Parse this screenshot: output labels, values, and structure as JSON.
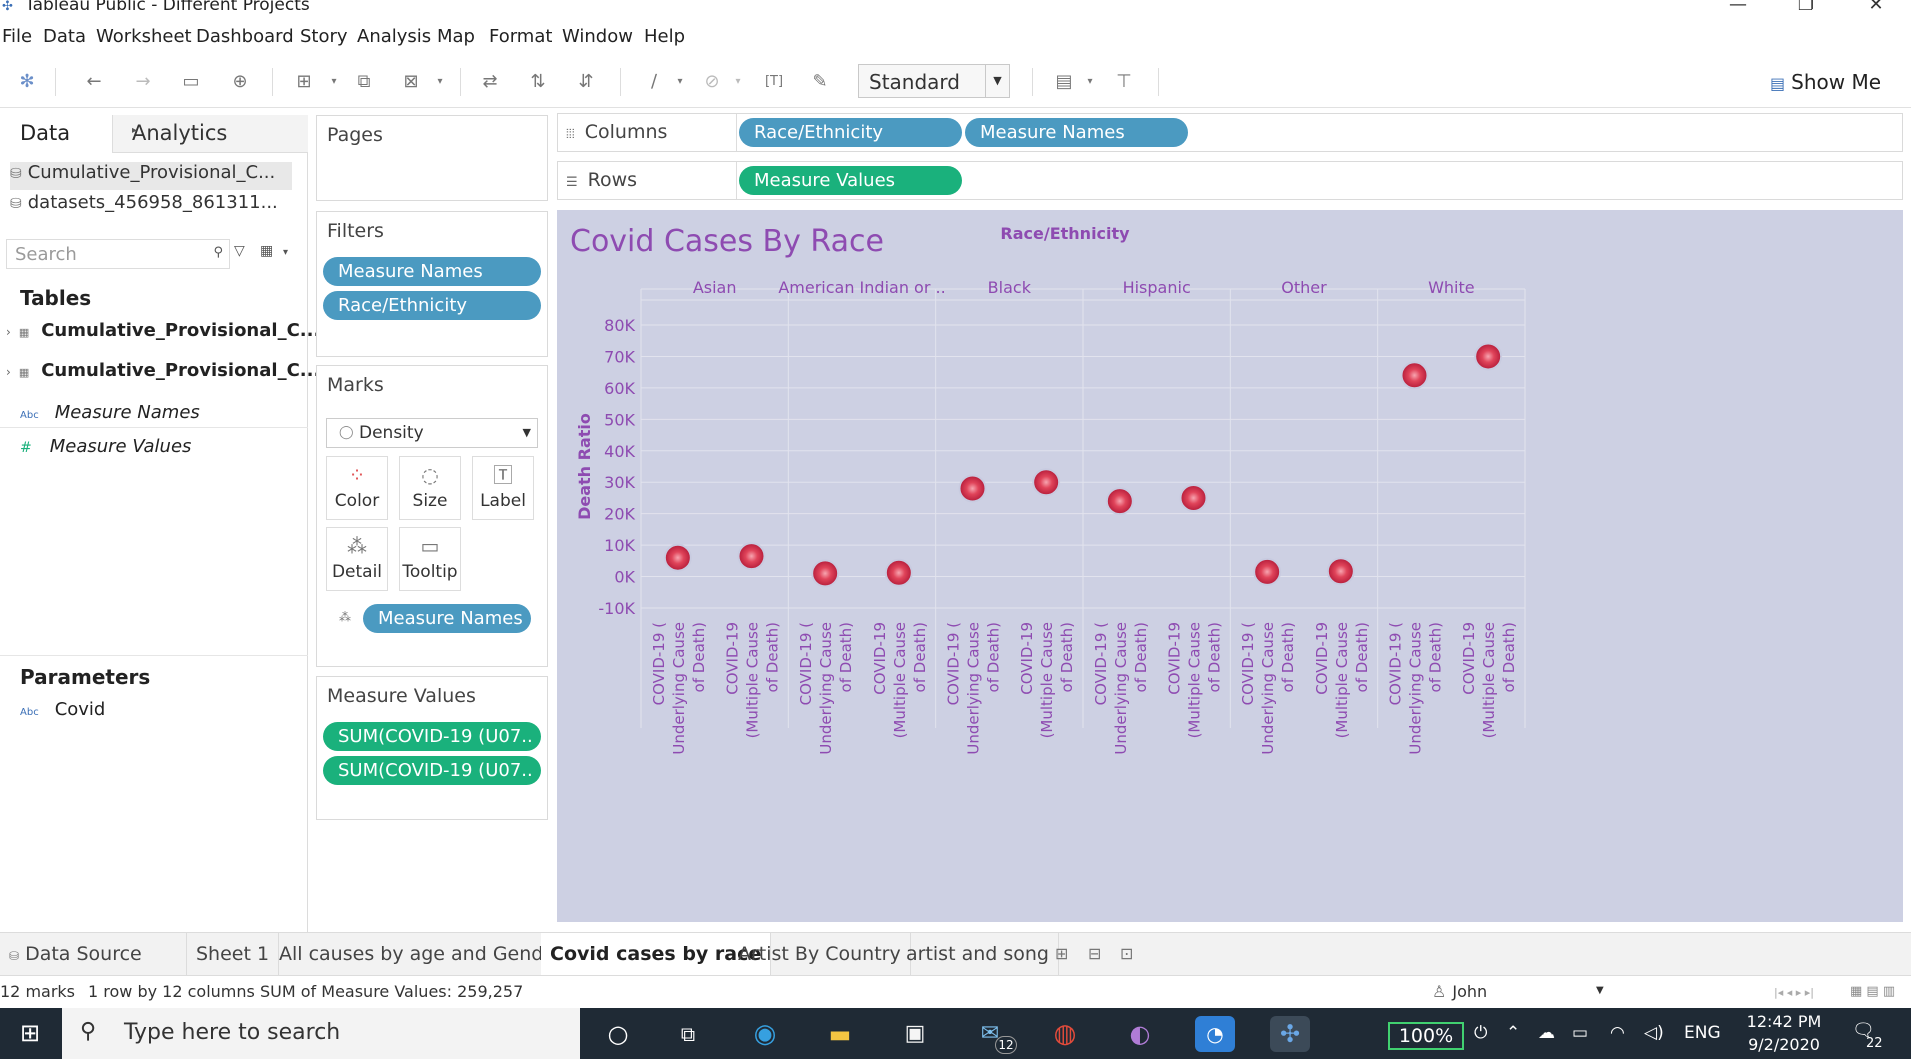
{
  "window": {
    "title": "Tableau Public - Different Projects"
  },
  "menu": [
    "File",
    "Data",
    "Worksheet",
    "Dashboard",
    "Story",
    "Analysis",
    "Map",
    "Format",
    "Window",
    "Help"
  ],
  "toolbar": {
    "fit_select": "Standard",
    "show_me": "Show Me"
  },
  "data_pane": {
    "tab_data": "Data",
    "tab_analytics": "Analytics",
    "datasources": [
      "Cumulative_Provisional_C...",
      "datasets_456958_861311..."
    ],
    "search_placeholder": "Search",
    "tables_heading": "Tables",
    "tables": [
      "Cumulative_Provisional_C...",
      "Cumulative_Provisional_C..."
    ],
    "fields": [
      "Measure Names",
      "Measure Values"
    ],
    "parameters_heading": "Parameters",
    "parameters": [
      "Covid"
    ]
  },
  "cards": {
    "pages": "Pages",
    "filters": "Filters",
    "filter_pills": [
      "Measure Names",
      "Race/Ethnicity"
    ],
    "marks": "Marks",
    "mark_type": "Density",
    "mark_buttons": [
      "Color",
      "Size",
      "Label",
      "Detail",
      "Tooltip"
    ],
    "marks_pill": "Measure Names",
    "measure_values": "Measure Values",
    "measure_pills": [
      "SUM(COVID-19 (U07..",
      "SUM(COVID-19 (U07.."
    ]
  },
  "shelves": {
    "columns_label": "Columns",
    "rows_label": "Rows",
    "columns_pills": [
      "Race/Ethnicity",
      "Measure Names"
    ],
    "rows_pills": [
      "Measure Values"
    ]
  },
  "viz": {
    "title": "Covid Cases By Race"
  },
  "chart_data": {
    "type": "scatter",
    "title": "Covid Cases By Race",
    "column_header": "Race/Ethnicity",
    "ylabel": "Death Ratio",
    "categories": [
      "Asian",
      "American Indian or ..",
      "Black",
      "Hispanic",
      "Other",
      "White"
    ],
    "measures": [
      [
        "COVID-19 (",
        "Underlying Cause",
        "of Death)"
      ],
      [
        "COVID-19",
        "(Multiple Cause",
        "of Death)"
      ]
    ],
    "series": [
      {
        "name": "COVID-19 (Underlying Cause of Death)",
        "values": [
          6000,
          1000,
          28000,
          24000,
          1500,
          64000
        ]
      },
      {
        "name": "COVID-19 (Multiple Cause of Death)",
        "values": [
          6500,
          1200,
          30000,
          25000,
          1700,
          70000
        ]
      }
    ],
    "ylim": [
      -10000,
      80000
    ],
    "y_ticks": [
      80000,
      70000,
      60000,
      50000,
      40000,
      30000,
      20000,
      10000,
      0,
      -10000
    ],
    "y_tick_labels": [
      "80K",
      "70K",
      "60K",
      "50K",
      "40K",
      "30K",
      "20K",
      "10K",
      "0K",
      "-10K"
    ],
    "grid": true,
    "mark_color": "#e0445a"
  },
  "sheet_tabs": {
    "data_source": "Data Source",
    "tabs": [
      "Sheet 1",
      "All causes by age and Gender",
      "Covid cases by race",
      "Artist By Country",
      "artist and song"
    ],
    "active": "Covid cases by race"
  },
  "status": {
    "marks": "12 marks",
    "rows_cols": "1 row by 12 columns",
    "sum": "SUM of Measure Values: 259,257",
    "user": "John"
  },
  "taskbar": {
    "search_placeholder": "Type here to search",
    "zoom": "100%",
    "lang": "ENG",
    "time": "12:42 PM",
    "date": "9/2/2020",
    "mail_badge": "12",
    "notif_count": "22"
  },
  "colors": {
    "accent_purple": "#8e4bb1",
    "pill_blue": "#4b9ac1",
    "pill_green": "#1ab17c",
    "viz_bg": "#cdd0e3"
  }
}
